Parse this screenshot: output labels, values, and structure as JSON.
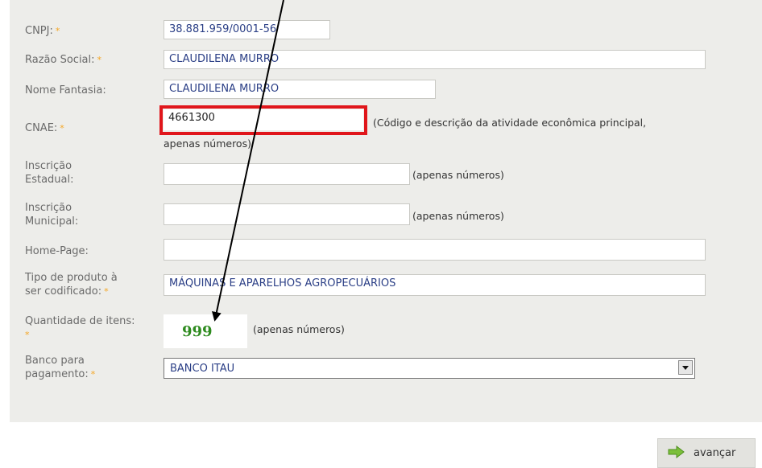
{
  "form": {
    "cnpj": {
      "label": "CNPJ:",
      "value": "38.881.959/0001-56"
    },
    "razao_social": {
      "label": "Razão Social:",
      "value": "CLAUDILENA MURRO"
    },
    "nome_fantasia": {
      "label": "Nome Fantasia:",
      "value": "CLAUDILENA MURRO"
    },
    "cnae": {
      "label": "CNAE:",
      "value": "4661300",
      "hint_line1": "(Código e descrição da atividade econômica principal,",
      "hint_line2": "apenas números)"
    },
    "inscricao_estadual": {
      "label_line1": "Inscrição",
      "label_line2": "Estadual:",
      "value": "",
      "hint": "(apenas números)"
    },
    "inscricao_municipal": {
      "label_line1": "Inscrição",
      "label_line2": "Municipal:",
      "value": "",
      "hint": "(apenas números)"
    },
    "home_page": {
      "label": "Home-Page:",
      "value": ""
    },
    "tipo_produto": {
      "label_line1": "Tipo de produto à",
      "label_line2": "ser codificado:",
      "value": "MÁQUINAS E APARELHOS AGROPECUÁRIOS"
    },
    "quantidade_itens": {
      "label": "Quantidade de itens:",
      "value": "999",
      "hint": "(apenas números)"
    },
    "banco": {
      "label_line1": "Banco para",
      "label_line2": "pagamento:",
      "selected": "BANCO ITAU"
    },
    "required_marker": "*"
  },
  "actions": {
    "next_label": "avançar"
  },
  "colors": {
    "highlight": "#e0161b",
    "required": "#f5a623",
    "value_text": "#2b3f86",
    "qty_value": "#2e8b1f",
    "panel_bg": "#ededea"
  }
}
